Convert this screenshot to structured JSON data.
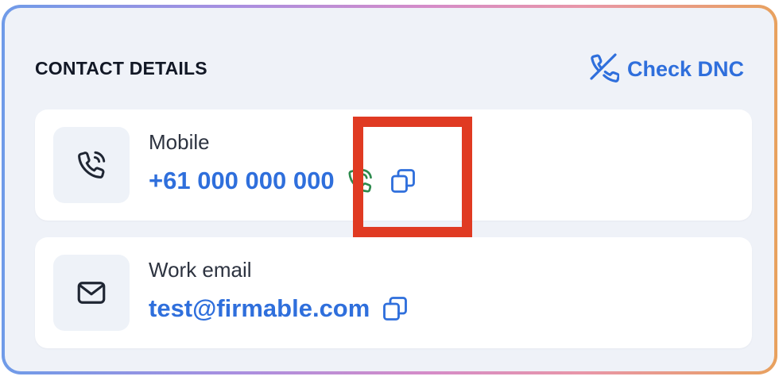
{
  "header": {
    "title": "CONTACT DETAILS",
    "dnc_label": "Check DNC",
    "dnc_icon": "phone-off-icon"
  },
  "contacts": [
    {
      "label": "Mobile",
      "value": "+61 000 000 000",
      "icon": "phone-icon",
      "actions": [
        "call-icon",
        "copy-icon"
      ]
    },
    {
      "label": "Work email",
      "value": "test@firmable.com",
      "icon": "mail-icon",
      "actions": [
        "copy-icon"
      ]
    }
  ],
  "colors": {
    "accent": "#2f6fdc",
    "call_green": "#2e8b4e",
    "card_bg": "#eff2f8",
    "highlight": "#e03a22"
  }
}
